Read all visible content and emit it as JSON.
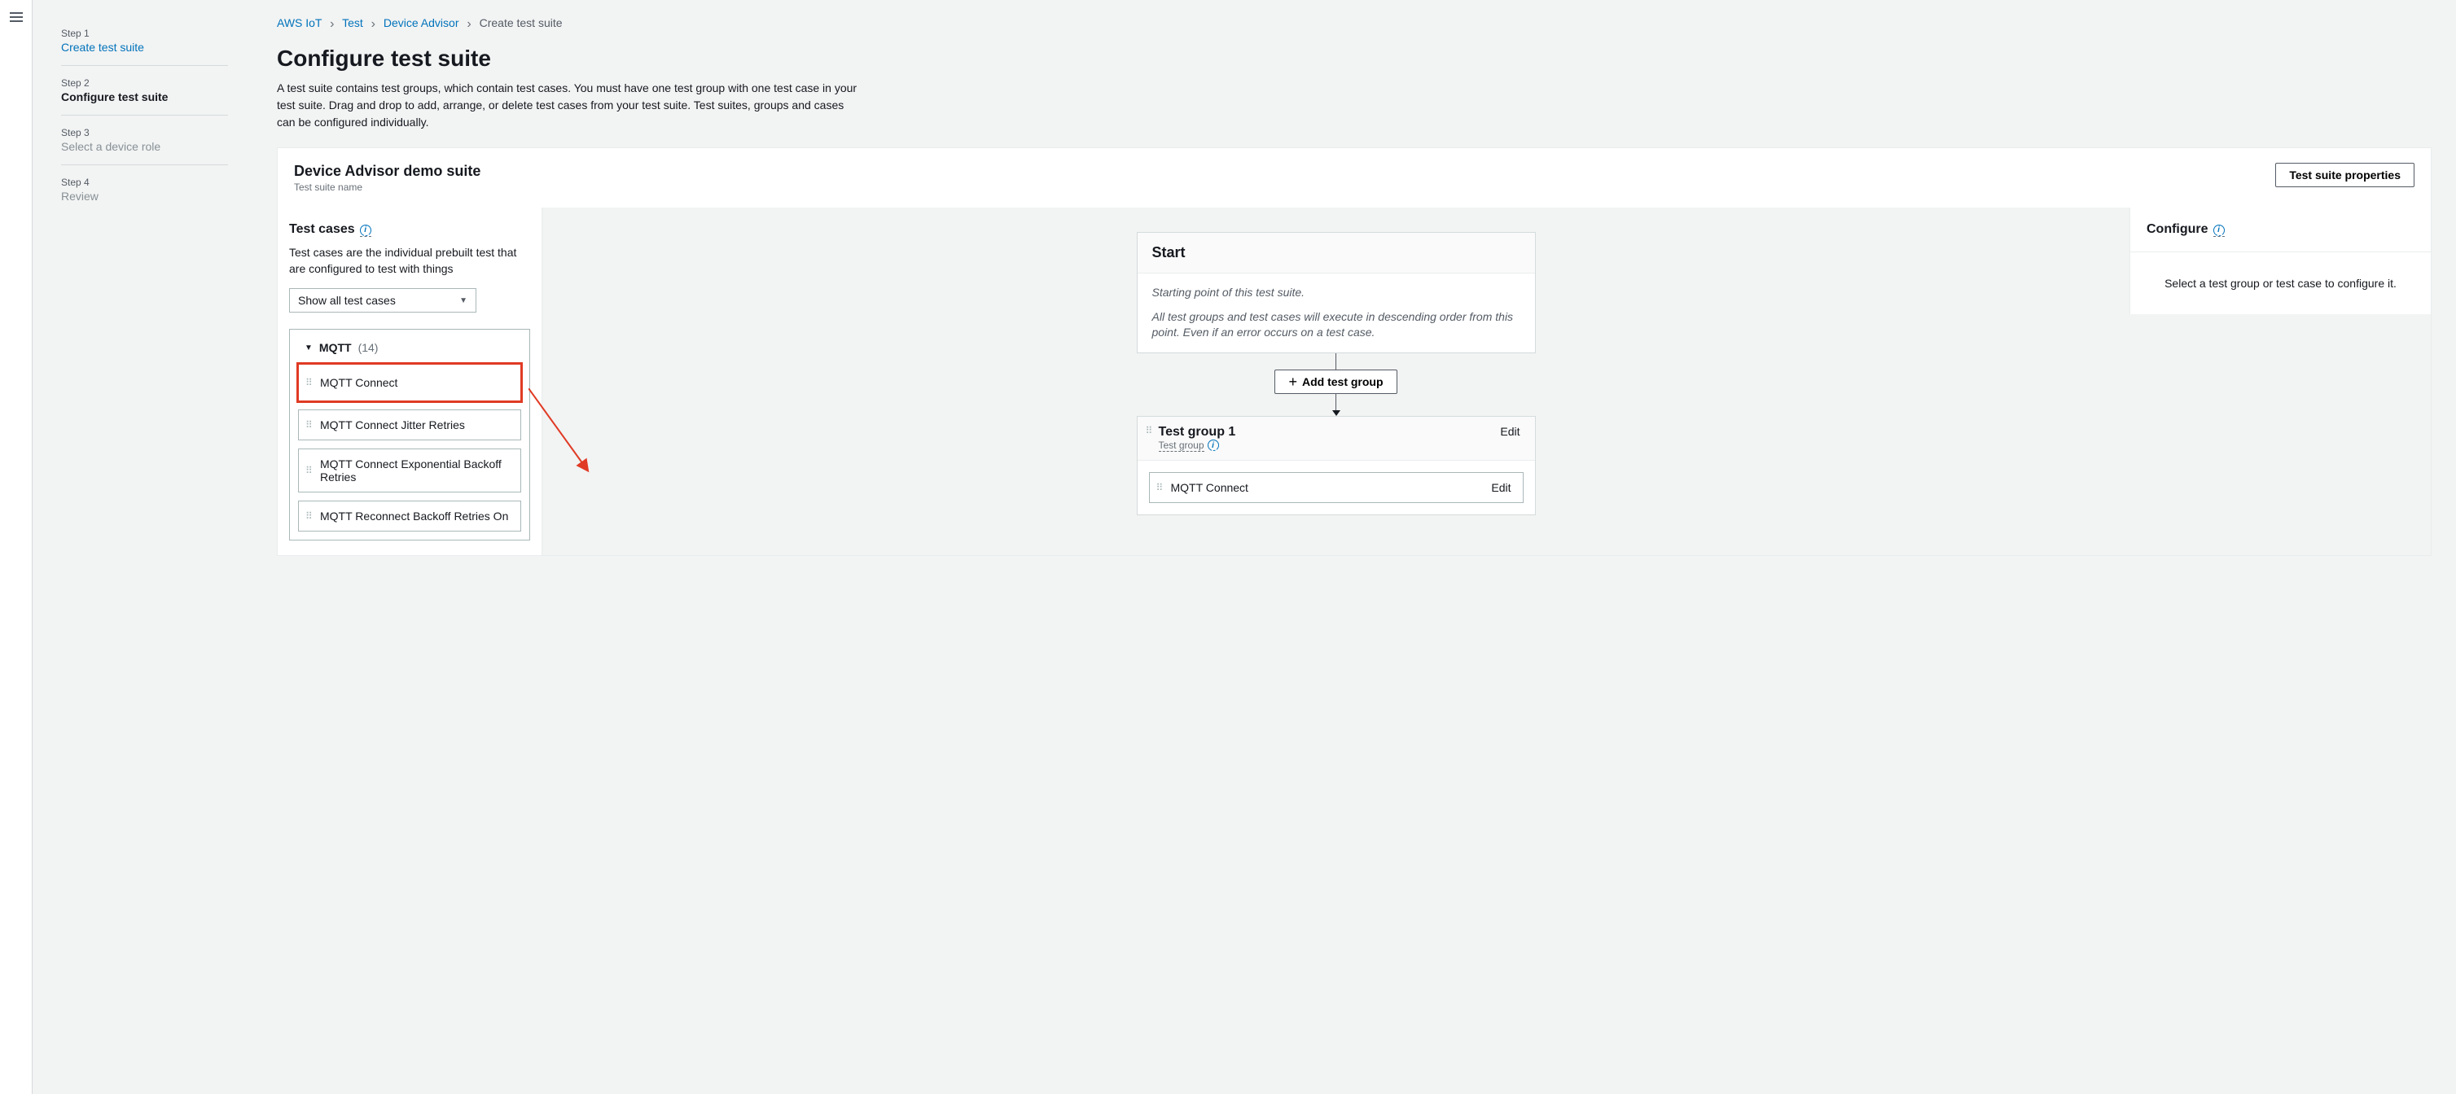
{
  "breadcrumb": {
    "items": [
      "AWS IoT",
      "Test",
      "Device Advisor",
      "Create test suite"
    ]
  },
  "steps": [
    {
      "num": "Step 1",
      "title": "Create test suite",
      "state": "link"
    },
    {
      "num": "Step 2",
      "title": "Configure test suite",
      "state": "active"
    },
    {
      "num": "Step 3",
      "title": "Select a device role",
      "state": "disabled"
    },
    {
      "num": "Step 4",
      "title": "Review",
      "state": "disabled"
    }
  ],
  "page": {
    "title": "Configure test suite",
    "description": "A test suite contains test groups, which contain test cases. You must have one test group with one test case in your test suite. Drag and drop to add, arrange, or delete test cases from your test suite. Test suites, groups and cases can be configured individually."
  },
  "suite": {
    "title": "Device Advisor demo suite",
    "subtitle": "Test suite name",
    "properties_btn": "Test suite properties"
  },
  "testcases": {
    "title": "Test cases",
    "description": "Test cases are the individual prebuilt test that are configured to test with things",
    "filter": "Show all test cases",
    "group_name": "MQTT",
    "group_count": "(14)",
    "items": [
      "MQTT Connect",
      "MQTT Connect Jitter Retries",
      "MQTT Connect Exponential Backoff Retries",
      "MQTT Reconnect Backoff Retries On"
    ]
  },
  "builder": {
    "start_title": "Start",
    "start_line1": "Starting point of this test suite.",
    "start_line2": "All test groups and test cases will execute in descending order from this point. Even if an error occurs on a test case.",
    "add_group": "Add test group",
    "group1_title": "Test group 1",
    "group1_sub": "Test group",
    "edit": "Edit",
    "placed_item": "MQTT Connect"
  },
  "configure": {
    "title": "Configure",
    "message": "Select a test group or test case to configure it."
  }
}
